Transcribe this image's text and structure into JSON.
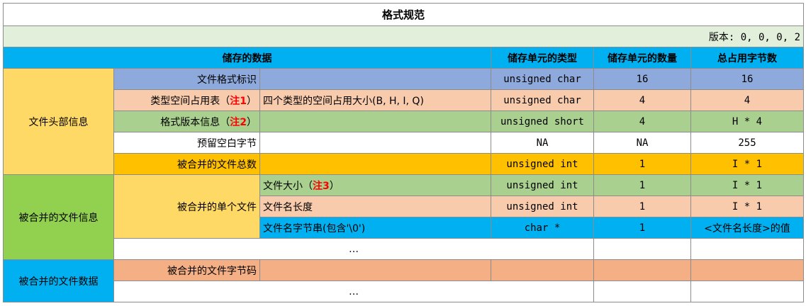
{
  "title": "格式规范",
  "version": "版本: 0, 0, 0, 2",
  "columns": {
    "data": "储存的数据",
    "unit_type": "储存单元的类型",
    "unit_count": "储存单元的数量",
    "total_bytes": "总占用字节数"
  },
  "groups": {
    "header": "文件头部信息",
    "merged_info": "被合并的文件信息",
    "merged_data": "被合并的文件数据"
  },
  "rows": {
    "format_id": {
      "label": "文件格式标识",
      "note": "",
      "type": "unsigned char",
      "count": "16",
      "bytes": "16"
    },
    "space_table": {
      "label": "类型空间占用表（",
      "note_mark": "注1",
      "label_end": "）",
      "desc": "四个类型的空间占用大小(B, H, I, Q)",
      "type": "unsigned char",
      "count": "4",
      "bytes": "4"
    },
    "format_version": {
      "label": "格式版本信息（",
      "note_mark": "注2",
      "label_end": "）",
      "type": "unsigned short",
      "count": "4",
      "bytes": "H * 4"
    },
    "reserved": {
      "label": "预留空白字节",
      "type": "NA",
      "count": "NA",
      "bytes": "255"
    },
    "file_total": {
      "label": "被合并的文件总数",
      "type": "unsigned int",
      "count": "1",
      "bytes": "I * 1"
    },
    "single_file": {
      "label": "被合并的单个文件"
    },
    "file_size": {
      "label": "文件大小（",
      "note_mark": "注3",
      "label_end": "）",
      "type": "unsigned int",
      "count": "1",
      "bytes": "I * 1"
    },
    "name_length": {
      "label": "文件名长度",
      "type": "unsigned int",
      "count": "1",
      "bytes": "I * 1"
    },
    "name_string": {
      "label": "文件名字节串(包含'\\0')",
      "type": "char *",
      "count": "1",
      "bytes": "<文件名长度>的值"
    },
    "ellipsis_1": "…",
    "file_bytes": {
      "label": "被合并的文件字节码"
    },
    "ellipsis_2": "…"
  }
}
